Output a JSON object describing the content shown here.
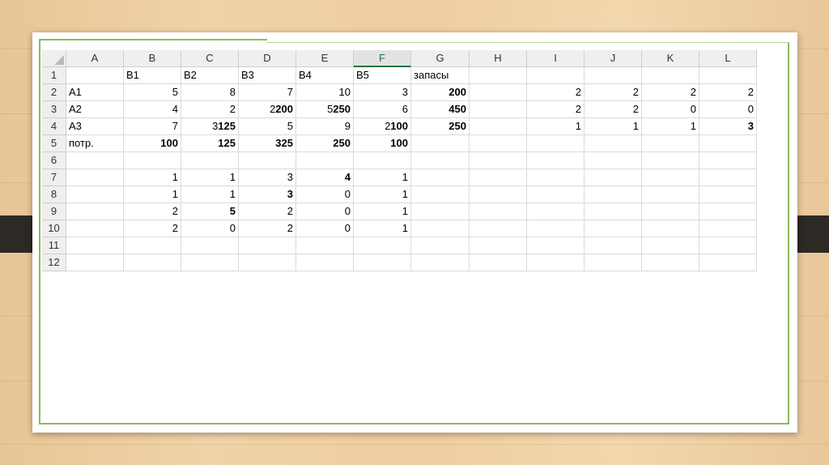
{
  "sheet": {
    "columns": [
      "A",
      "B",
      "C",
      "D",
      "E",
      "F",
      "G",
      "H",
      "I",
      "J",
      "K",
      "L"
    ],
    "selected_column": "F",
    "rows": [
      {
        "n": "1",
        "cells": [
          {
            "t": ""
          },
          {
            "t": "B1"
          },
          {
            "t": "B2"
          },
          {
            "t": "B3"
          },
          {
            "t": "B4"
          },
          {
            "t": "B5"
          },
          {
            "t": "запасы"
          },
          {
            "t": ""
          },
          {
            "t": ""
          },
          {
            "t": ""
          },
          {
            "t": ""
          },
          {
            "t": ""
          }
        ]
      },
      {
        "n": "2",
        "cells": [
          {
            "t": "A1"
          },
          {
            "t": "5",
            "num": true
          },
          {
            "t": "8",
            "num": true
          },
          {
            "t": "7",
            "num": true
          },
          {
            "t": "10",
            "num": true
          },
          {
            "t": "3",
            "num": true
          },
          {
            "t": "200",
            "num": true,
            "b": true
          },
          {
            "t": ""
          },
          {
            "t": "2",
            "num": true
          },
          {
            "t": "2",
            "num": true
          },
          {
            "t": "2",
            "num": true
          },
          {
            "t": "2",
            "num": true
          }
        ]
      },
      {
        "n": "3",
        "cells": [
          {
            "t": "A2"
          },
          {
            "t": "4",
            "num": true
          },
          {
            "t": "2",
            "num": true
          },
          {
            "pre": "2",
            "t": "200",
            "num": true,
            "b": true
          },
          {
            "pre": "5",
            "t": "250",
            "num": true,
            "b": true
          },
          {
            "t": "6",
            "num": true
          },
          {
            "t": "450",
            "num": true,
            "b": true
          },
          {
            "t": ""
          },
          {
            "t": "2",
            "num": true
          },
          {
            "t": "2",
            "num": true
          },
          {
            "t": "0",
            "num": true
          },
          {
            "t": "0",
            "num": true
          }
        ]
      },
      {
        "n": "4",
        "cells": [
          {
            "t": "A3"
          },
          {
            "t": "7",
            "num": true
          },
          {
            "pre": "3",
            "t": "125",
            "num": true,
            "b": true
          },
          {
            "t": "5",
            "num": true
          },
          {
            "t": "9",
            "num": true
          },
          {
            "pre": "2",
            "t": "100",
            "num": true,
            "b": true
          },
          {
            "t": "250",
            "num": true,
            "b": true
          },
          {
            "t": ""
          },
          {
            "t": "1",
            "num": true
          },
          {
            "t": "1",
            "num": true
          },
          {
            "t": "1",
            "num": true
          },
          {
            "t": "3",
            "num": true,
            "b": true
          }
        ]
      },
      {
        "n": "5",
        "cells": [
          {
            "t": "потр."
          },
          {
            "t": "100",
            "num": true,
            "b": true
          },
          {
            "t": "125",
            "num": true,
            "b": true
          },
          {
            "t": "325",
            "num": true,
            "b": true
          },
          {
            "t": "250",
            "num": true,
            "b": true
          },
          {
            "t": "100",
            "num": true,
            "b": true
          },
          {
            "t": ""
          },
          {
            "t": ""
          },
          {
            "t": ""
          },
          {
            "t": ""
          },
          {
            "t": ""
          },
          {
            "t": ""
          }
        ]
      },
      {
        "n": "6",
        "cells": [
          {
            "t": ""
          },
          {
            "t": ""
          },
          {
            "t": ""
          },
          {
            "t": ""
          },
          {
            "t": ""
          },
          {
            "t": ""
          },
          {
            "t": ""
          },
          {
            "t": ""
          },
          {
            "t": ""
          },
          {
            "t": ""
          },
          {
            "t": ""
          },
          {
            "t": ""
          }
        ]
      },
      {
        "n": "7",
        "cells": [
          {
            "t": ""
          },
          {
            "t": "1",
            "num": true
          },
          {
            "t": "1",
            "num": true
          },
          {
            "t": "3",
            "num": true
          },
          {
            "t": "4",
            "num": true,
            "b": true
          },
          {
            "t": "1",
            "num": true
          },
          {
            "t": ""
          },
          {
            "t": ""
          },
          {
            "t": ""
          },
          {
            "t": ""
          },
          {
            "t": ""
          },
          {
            "t": ""
          }
        ]
      },
      {
        "n": "8",
        "cells": [
          {
            "t": ""
          },
          {
            "t": "1",
            "num": true
          },
          {
            "t": "1",
            "num": true
          },
          {
            "t": "3",
            "num": true,
            "b": true
          },
          {
            "t": "0",
            "num": true
          },
          {
            "t": "1",
            "num": true
          },
          {
            "t": ""
          },
          {
            "t": ""
          },
          {
            "t": ""
          },
          {
            "t": ""
          },
          {
            "t": ""
          },
          {
            "t": ""
          }
        ]
      },
      {
        "n": "9",
        "cells": [
          {
            "t": ""
          },
          {
            "t": "2",
            "num": true
          },
          {
            "t": "5",
            "num": true,
            "b": true
          },
          {
            "t": "2",
            "num": true
          },
          {
            "t": "0",
            "num": true
          },
          {
            "t": "1",
            "num": true
          },
          {
            "t": ""
          },
          {
            "t": ""
          },
          {
            "t": ""
          },
          {
            "t": ""
          },
          {
            "t": ""
          },
          {
            "t": ""
          }
        ]
      },
      {
        "n": "10",
        "cells": [
          {
            "t": ""
          },
          {
            "t": "2",
            "num": true
          },
          {
            "t": "0",
            "num": true
          },
          {
            "t": "2",
            "num": true
          },
          {
            "t": "0",
            "num": true
          },
          {
            "t": "1",
            "num": true
          },
          {
            "t": ""
          },
          {
            "t": ""
          },
          {
            "t": ""
          },
          {
            "t": ""
          },
          {
            "t": ""
          },
          {
            "t": ""
          }
        ]
      },
      {
        "n": "11",
        "cells": [
          {
            "t": ""
          },
          {
            "t": ""
          },
          {
            "t": ""
          },
          {
            "t": ""
          },
          {
            "t": ""
          },
          {
            "t": ""
          },
          {
            "t": ""
          },
          {
            "t": ""
          },
          {
            "t": ""
          },
          {
            "t": ""
          },
          {
            "t": ""
          },
          {
            "t": ""
          }
        ]
      },
      {
        "n": "12",
        "cells": [
          {
            "t": ""
          },
          {
            "t": ""
          },
          {
            "t": ""
          },
          {
            "t": ""
          },
          {
            "t": ""
          },
          {
            "t": ""
          },
          {
            "t": ""
          },
          {
            "t": ""
          },
          {
            "t": ""
          },
          {
            "t": ""
          },
          {
            "t": ""
          },
          {
            "t": ""
          }
        ]
      }
    ]
  }
}
